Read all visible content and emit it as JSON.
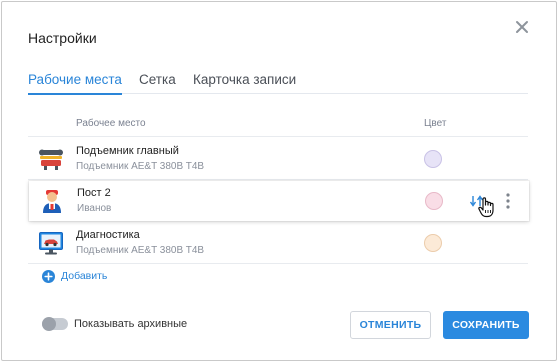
{
  "dialog": {
    "title": "Настройки"
  },
  "tabs": [
    {
      "label": "Рабочие места",
      "active": true
    },
    {
      "label": "Сетка",
      "active": false
    },
    {
      "label": "Карточка записи",
      "active": false
    }
  ],
  "table": {
    "col_workplace": "Рабочее место",
    "col_color": "Цвет",
    "rows": [
      {
        "name": "Подъемник главный",
        "subtitle": "Подъемник AE&T 380B T4B",
        "icon": "lift-wrench-icon",
        "color": "#e7e3f7",
        "color_border": "#c9c2e6"
      },
      {
        "name": "Пост 2",
        "subtitle": "Иванов",
        "icon": "mechanic-person-icon",
        "color": "#f9dde6",
        "color_border": "#e8b9c8"
      },
      {
        "name": "Диагностика",
        "subtitle": "Подъемник AE&T 380B T4B",
        "icon": "diagnostics-monitor-icon",
        "color": "#fcead7",
        "color_border": "#ecccab"
      }
    ]
  },
  "add_label": "Добавить",
  "show_archived_label": "Показывать архивные",
  "show_archived": false,
  "buttons": {
    "cancel": "ОТМЕНИТЬ",
    "save": "СОХРАНИТЬ"
  },
  "colors": {
    "accent": "#2a85d8",
    "primary_button": "#2b8ae0"
  }
}
